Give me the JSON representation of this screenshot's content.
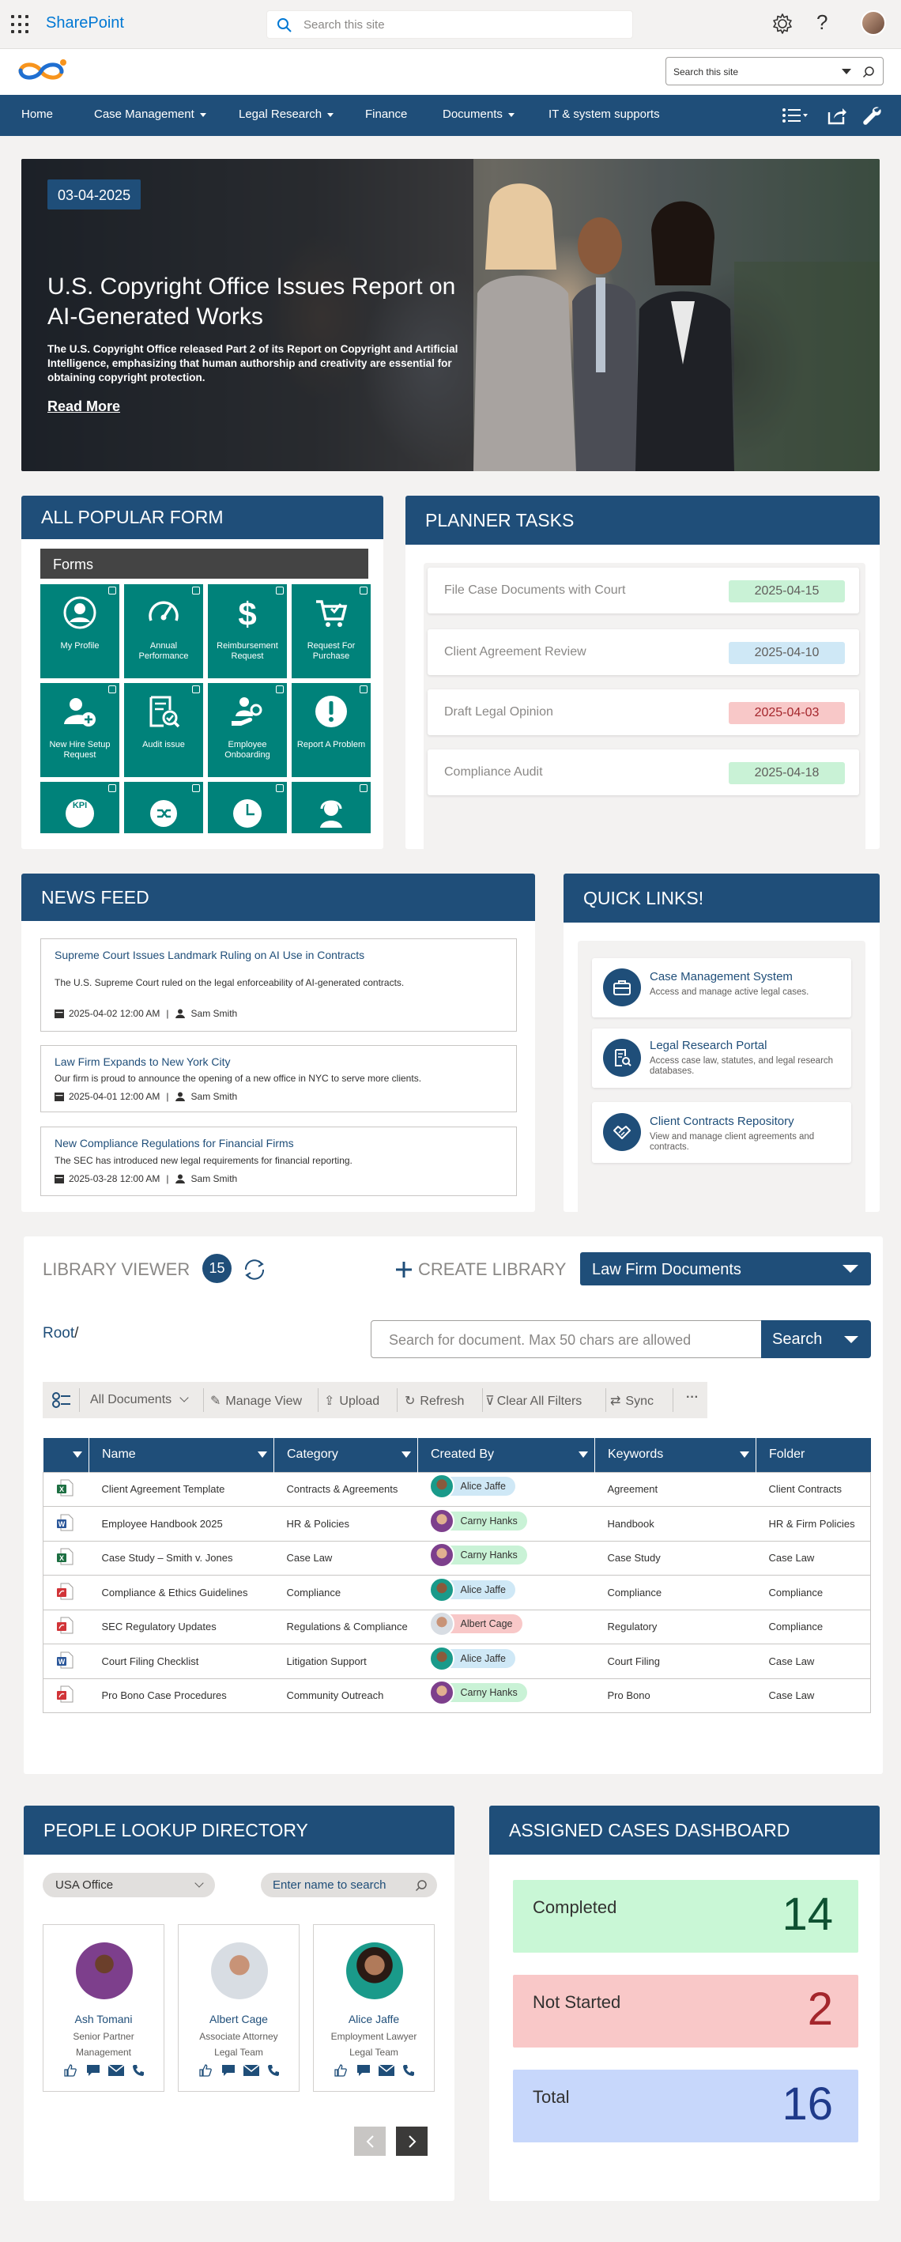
{
  "suite": {
    "app_name": "SharePoint",
    "search_placeholder": "Search this site"
  },
  "site_header": {
    "search_placeholder": "Search this site"
  },
  "nav": {
    "items": [
      {
        "label": "Home"
      },
      {
        "label": "Case Management"
      },
      {
        "label": "Legal Research"
      },
      {
        "label": "Finance"
      },
      {
        "label": "Documents"
      },
      {
        "label": "IT & system supports"
      }
    ]
  },
  "hero": {
    "date": "03-04-2025",
    "title": "U.S. Copyright Office Issues Report on AI-Generated Works",
    "description": "The U.S. Copyright Office released Part 2 of its Report on Copyright and Artificial Intelligence, emphasizing that human authorship and creativity are essential for obtaining copyright protection.",
    "read_more": "Read More"
  },
  "forms": {
    "title": "ALL POPULAR FORM",
    "section_label": "Forms",
    "tiles": [
      {
        "label": "My Profile",
        "icon": "user-icon"
      },
      {
        "label": "Annual Performance",
        "icon": "gauge-icon"
      },
      {
        "label": "Reimbursement Request",
        "icon": "dollar-icon"
      },
      {
        "label": "Request For Purchase",
        "icon": "cart-icon"
      },
      {
        "label": "New Hire Setup Request",
        "icon": "add-user-icon"
      },
      {
        "label": "Audit issue",
        "icon": "audit-icon"
      },
      {
        "label": "Employee Onboarding",
        "icon": "onboarding-icon"
      },
      {
        "label": "Report A Problem",
        "icon": "alert-icon"
      }
    ]
  },
  "planner": {
    "title": "PLANNER TASKS",
    "tasks": [
      {
        "name": "File Case Documents with Court",
        "date": "2025-04-15",
        "color": "#c9f2d6"
      },
      {
        "name": "Client Agreement Review",
        "date": "2025-04-10",
        "color": "#cfe8f6"
      },
      {
        "name": "Draft Legal Opinion",
        "date": "2025-04-03",
        "color": "#f8c8c8"
      },
      {
        "name": "Compliance Audit",
        "date": "2025-04-18",
        "color": "#c9f2d6"
      }
    ]
  },
  "news": {
    "title": "NEWS FEED",
    "items": [
      {
        "title": "Supreme Court Issues Landmark Ruling on AI Use in Contracts",
        "desc": "The U.S. Supreme Court ruled on the legal enforceability of AI-generated contracts.",
        "date": "2025-04-02  12:00 AM",
        "author": "Sam Smith"
      },
      {
        "title": "Law Firm Expands to New York City",
        "desc": "Our firm is proud to announce the opening of a new office in NYC to serve more clients.",
        "date": "2025-04-01  12:00 AM",
        "author": "Sam Smith"
      },
      {
        "title": "New Compliance Regulations for Financial Firms",
        "desc": "The SEC has introduced new legal requirements for financial reporting.",
        "date": "2025-03-28  12:00 AM",
        "author": "Sam Smith"
      }
    ]
  },
  "quick_links": {
    "title": "QUICK LINKS!",
    "items": [
      {
        "title": "Case Management System",
        "desc": "Access and manage active legal cases.",
        "icon": "briefcase-icon"
      },
      {
        "title": "Legal Research Portal",
        "desc": "Access case law, statutes, and legal research databases.",
        "icon": "research-icon"
      },
      {
        "title": "Client Contracts Repository",
        "desc": "View and manage client agreements and contracts.",
        "icon": "handshake-icon"
      }
    ]
  },
  "library": {
    "title": "LIBRARY VIEWER",
    "count": "15",
    "create_label": "CREATE LIBRARY",
    "selected_library": "Law Firm Documents",
    "root": "Root",
    "root_sep": "/",
    "search_placeholder": "Search for document. Max 50 chars are allowed",
    "search_button": "Search",
    "commands": {
      "view": "All Documents",
      "manage": "Manage View",
      "upload": "Upload",
      "refresh": "Refresh",
      "clear": "Clear All Filters",
      "sync": "Sync",
      "more": "···"
    },
    "columns": {
      "name": "Name",
      "category": "Category",
      "created_by": "Created By",
      "keywords": "Keywords",
      "folder": "Folder"
    },
    "rows": [
      {
        "type": "excel",
        "name": "Client Agreement Template",
        "category": "Contracts & Agreements",
        "created_by": "Alice Jaffe",
        "keywords": "Agreement",
        "folder": "Client Contracts"
      },
      {
        "type": "word",
        "name": "Employee Handbook 2025",
        "category": "HR & Policies",
        "created_by": "Carny Hanks",
        "keywords": "Handbook",
        "folder": "HR & Firm Policies"
      },
      {
        "type": "excel",
        "name": " Case Study – Smith v. Jones",
        "category": "Case Law",
        "created_by": "Carny Hanks",
        "keywords": "Case Study",
        "folder": "Case Law"
      },
      {
        "type": "pdf",
        "name": "Compliance & Ethics Guidelines",
        "category": "Compliance",
        "created_by": "Alice Jaffe",
        "keywords": "Compliance",
        "folder": "Compliance"
      },
      {
        "type": "pdf",
        "name": "SEC Regulatory Updates",
        "category": "Regulations & Compliance",
        "created_by": "Albert Cage",
        "keywords": "Regulatory",
        "folder": "Compliance"
      },
      {
        "type": "word",
        "name": "Court Filing Checklist",
        "category": "Litigation Support",
        "created_by": "Alice Jaffe",
        "keywords": "Court Filing",
        "folder": "Case Law"
      },
      {
        "type": "pdf",
        "name": "Pro Bono Case Procedures",
        "category": "Community Outreach",
        "created_by": "Carny Hanks",
        "keywords": "Pro Bono",
        "folder": "Case Law"
      }
    ],
    "pill_colors": {
      "Alice Jaffe": "#cfe8f6",
      "Carny Hanks": "#c9f2d6",
      "Albert Cage": "#f8c8c8"
    }
  },
  "people": {
    "title": "PEOPLE LOOKUP DIRECTORY",
    "location": "USA Office",
    "search_placeholder": "Enter name to search",
    "items": [
      {
        "name": "Ash Tomani",
        "role": "Senior Partner",
        "team": "Management"
      },
      {
        "name": "Albert Cage",
        "role": "Associate Attorney",
        "team": "Legal Team"
      },
      {
        "name": "Alice Jaffe",
        "role": "Employment Lawyer",
        "team": "Legal Team"
      }
    ]
  },
  "cases": {
    "title": "ASSIGNED CASES DASHBOARD",
    "items": [
      {
        "label": "Completed",
        "value": "14",
        "bg": "#c9f7d6",
        "fg": "#0f5132"
      },
      {
        "label": "Not Started",
        "value": "2",
        "bg": "#f9c8c8",
        "fg": "#a4262c"
      },
      {
        "label": "Total",
        "value": "16",
        "bg": "#c7d7fb",
        "fg": "#1f3a8a"
      }
    ]
  }
}
